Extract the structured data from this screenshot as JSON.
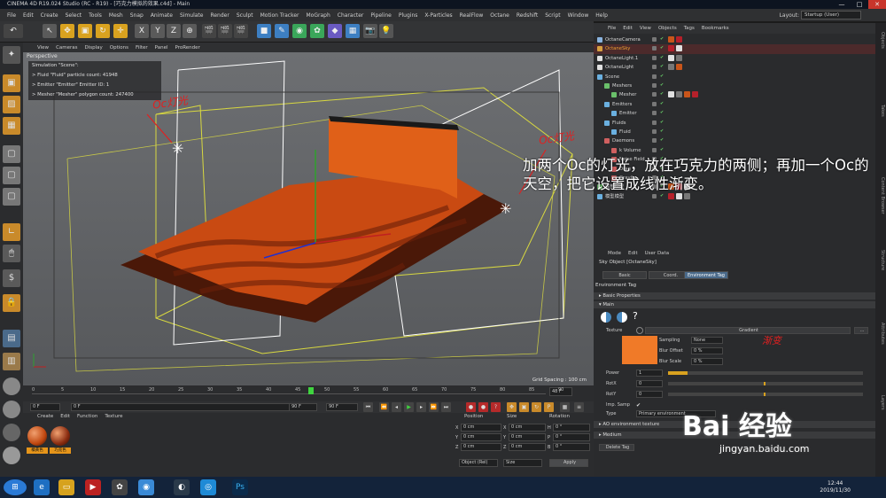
{
  "window": {
    "title": "CINEMA 4D R19.024 Studio (RC - R19) - [巧克力模拟的效果.c4d] - Main",
    "min": "—",
    "max": "□",
    "close": "✕"
  },
  "menubar": [
    "File",
    "Edit",
    "Create",
    "Select",
    "Tools",
    "Mesh",
    "Snap",
    "Animate",
    "Simulate",
    "Render",
    "Sculpt",
    "Motion Tracker",
    "MoGraph",
    "Character",
    "Pipeline",
    "Plugins",
    "X-Particles",
    "RealFlow",
    "Octane",
    "Redshift",
    "Script",
    "Window",
    "Help"
  ],
  "layout": {
    "label": "Layout:",
    "value": "Startup (User)"
  },
  "toolbar": {
    "axis_x": "X",
    "axis_y": "Y",
    "axis_z": "Z"
  },
  "viewport_menu": [
    "View",
    "Cameras",
    "Display",
    "Options",
    "Filter",
    "Panel",
    "ProRender"
  ],
  "viewport": {
    "label": "Perspective",
    "sim_info": [
      "Simulation \"Scene\":",
      "> Fluid \"Fluid\" particle count: 41948",
      "> Emitter \"Emitter\" Emitter ID: 1",
      "> Mesher \"Mesher\" polygon count: 247400"
    ],
    "grid_spacing": "Grid Spacing : 100 cm",
    "annotation_left": "Oc灯光",
    "annotation_right": "Oc灯光"
  },
  "callout": {
    "text": "加两个Oc的灯光，放在巧克力的两侧；再加一个Oc的天空，把它设置成线性渐变。"
  },
  "timeline": {
    "ticks": [
      "0",
      "5",
      "10",
      "15",
      "20",
      "25",
      "30",
      "35",
      "40",
      "45",
      "50",
      "55",
      "60",
      "65",
      "70",
      "75",
      "80",
      "85",
      "90"
    ],
    "current": "48",
    "end_label": "48 F"
  },
  "playbar": {
    "start": "0 F",
    "start2": "0 F",
    "end": "90 F",
    "end2": "90 F"
  },
  "material_menu": [
    "Create",
    "Edit",
    "Function",
    "Texture"
  ],
  "materials": [
    {
      "name": "橘黄色",
      "color": "#c0470f"
    },
    {
      "name": "巧克色",
      "color": "#8a2c10"
    }
  ],
  "coords": {
    "headers": [
      "Position",
      "Size",
      "Rotation"
    ],
    "rows": [
      {
        "axis": "X",
        "pos": "0 cm",
        "size_axis": "X",
        "size": "0 cm",
        "rot_axis": "H",
        "rot": "0 °"
      },
      {
        "axis": "Y",
        "pos": "0 cm",
        "size_axis": "Y",
        "size": "0 cm",
        "rot_axis": "P",
        "rot": "0 °"
      },
      {
        "axis": "Z",
        "pos": "0 cm",
        "size_axis": "Z",
        "size": "0 cm",
        "rot_axis": "B",
        "rot": "0 °"
      }
    ],
    "mode": "Object (Rel)",
    "size_mode": "Size",
    "apply": "Apply"
  },
  "object_menu": [
    "File",
    "Edit",
    "View",
    "Objects",
    "Tags",
    "Bookmarks"
  ],
  "objects": [
    {
      "name": "OctaneCamera",
      "indent": 0,
      "color": "#8ab4e0",
      "hl": false
    },
    {
      "name": "OctaneSky",
      "indent": 0,
      "color": "#d8a040",
      "hl": true
    },
    {
      "name": "OctaneLight.1",
      "indent": 0,
      "color": "#e0e0e0",
      "hl": false
    },
    {
      "name": "OctaneLight",
      "indent": 0,
      "color": "#e0e0e0",
      "hl": false
    },
    {
      "name": "Scene",
      "indent": 0,
      "color": "#6ab0e0",
      "hl": false
    },
    {
      "name": "Meshers",
      "indent": 1,
      "color": "#6ac06a",
      "hl": false
    },
    {
      "name": "Mesher",
      "indent": 2,
      "color": "#6ac06a",
      "hl": false
    },
    {
      "name": "Emitters",
      "indent": 1,
      "color": "#6ab0e0",
      "hl": false
    },
    {
      "name": "Emitter",
      "indent": 2,
      "color": "#6ab0e0",
      "hl": false
    },
    {
      "name": "Fluids",
      "indent": 1,
      "color": "#6ab0e0",
      "hl": false
    },
    {
      "name": "Fluid",
      "indent": 2,
      "color": "#6ab0e0",
      "hl": false
    },
    {
      "name": "Daemons",
      "indent": 1,
      "color": "#d06060",
      "hl": false
    },
    {
      "name": "k Volume",
      "indent": 2,
      "color": "#d06060",
      "hl": false
    },
    {
      "name": "Noise Field",
      "indent": 2,
      "color": "#d06060",
      "hl": false
    },
    {
      "name": "Drag",
      "indent": 2,
      "color": "#d06060",
      "hl": false
    },
    {
      "name": "Gravity",
      "indent": 2,
      "color": "#d06060",
      "hl": false
    },
    {
      "name": "底部模型",
      "indent": 0,
      "color": "#6ac06a",
      "hl": false
    },
    {
      "name": "模型模型",
      "indent": 0,
      "color": "#6ab0e0",
      "hl": false
    }
  ],
  "side_tabs": [
    "Objects",
    "Takes",
    "Content Browser",
    "Structure",
    "Attributes",
    "Layers"
  ],
  "attributes": {
    "menu": [
      "Mode",
      "Edit",
      "User Data"
    ],
    "title": "Sky Object [OctaneSky]",
    "tabs": [
      "Basic",
      "Coord.",
      "Environment Tag"
    ],
    "section_title": "Environment Tag",
    "basic_properties": "▸ Basic Properties",
    "main": "▾ Main",
    "question": "?",
    "texture_label": "Texture",
    "texture_value": "Gradient",
    "more": "...",
    "sampling_label": "Sampling",
    "sampling_value": "None",
    "blur_offset_label": "Blur Offset",
    "blur_offset_value": "0 %",
    "blur_scale_label": "Blur Scale",
    "blur_scale_value": "0 %",
    "power_label": "Power",
    "power_value": "1",
    "rotx_label": "RotX",
    "rotx_value": "0",
    "roty_label": "RotY",
    "roty_value": "0",
    "imp_samp_label": "Imp. Samp",
    "type_label": "Type",
    "type_value": "Primary environment",
    "ao_env": "▸ AO environment texture",
    "medium": "▸ Medium",
    "delete_tag": "Delete Tag",
    "annotation": "渐变",
    "swatch": "#f07a28"
  },
  "taskbar": {
    "time": "12:44",
    "date": "2019/11/30"
  },
  "watermark": {
    "logo": "Bai 经验",
    "url": "jingyan.baidu.com"
  }
}
